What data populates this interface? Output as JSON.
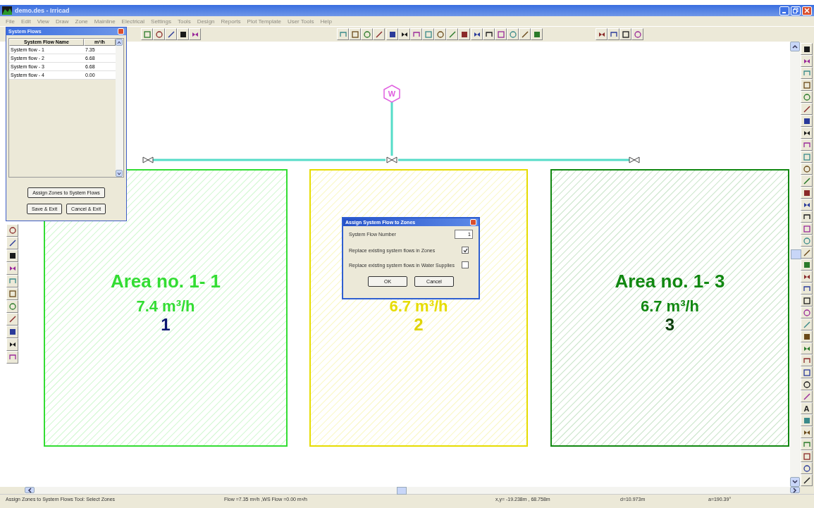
{
  "window": {
    "title": "demo.des - Irricad"
  },
  "menu": [
    {
      "label": "File",
      "disabled": true
    },
    {
      "label": "Edit",
      "disabled": true
    },
    {
      "label": "View",
      "disabled": true
    },
    {
      "label": "Draw",
      "disabled": true
    },
    {
      "label": "Zone",
      "disabled": true
    },
    {
      "label": "Mainline",
      "disabled": true
    },
    {
      "label": "Electrical",
      "disabled": true
    },
    {
      "label": "Settings",
      "disabled": true
    },
    {
      "label": "Tools",
      "disabled": true
    },
    {
      "label": "Design",
      "disabled": true
    },
    {
      "label": "Reports",
      "disabled": true
    },
    {
      "label": "Plot Template",
      "disabled": true
    },
    {
      "label": "User Tools",
      "disabled": true
    },
    {
      "label": "Help",
      "disabled": true
    }
  ],
  "canvas": {
    "water_source": "W",
    "zones": [
      {
        "title": "Area no.  1- 1",
        "flow": "7.4 m³/h",
        "number": "1",
        "color": "#33dd33"
      },
      {
        "flow": "6.7 m³/h",
        "number": "2",
        "color": "#e6dc00"
      },
      {
        "title": "Area no.  1- 3",
        "flow": "6.7 m³/h",
        "number": "3",
        "color": "#118811"
      }
    ]
  },
  "right_toolbar": {
    "text_button": "A"
  },
  "system_flows": {
    "title": "System Flows",
    "columns": [
      "System Flow Name",
      "m³/h"
    ],
    "rows": [
      {
        "name": "System flow - 1",
        "flow": "7.35"
      },
      {
        "name": "System flow - 2",
        "flow": "6.68"
      },
      {
        "name": "System flow - 3",
        "flow": "6.68"
      },
      {
        "name": "System flow - 4",
        "flow": "0.00"
      }
    ],
    "buttons": [
      "Assign Zones to System Flows",
      "Save & Exit",
      "Cancel & Exit"
    ]
  },
  "dialog": {
    "title": "Assign System Flow to Zones",
    "number_label": "System Flow Number",
    "number_value": "1",
    "options": [
      {
        "label": "Replace existing system flows in Zones",
        "checked": true
      },
      {
        "label": "Replace existing system flows in Water Supplies",
        "checked": false
      }
    ],
    "buttons": [
      "OK",
      "Cancel"
    ]
  },
  "status_bar": [
    "Assign Zones to System Flows Tool: Select Zones",
    "Flow =7.35 m³/h ,WS Flow =0.00 m³/h",
    "x,y= -19.238m , 68.758m",
    "d=10.973m",
    "a=190.39°"
  ]
}
